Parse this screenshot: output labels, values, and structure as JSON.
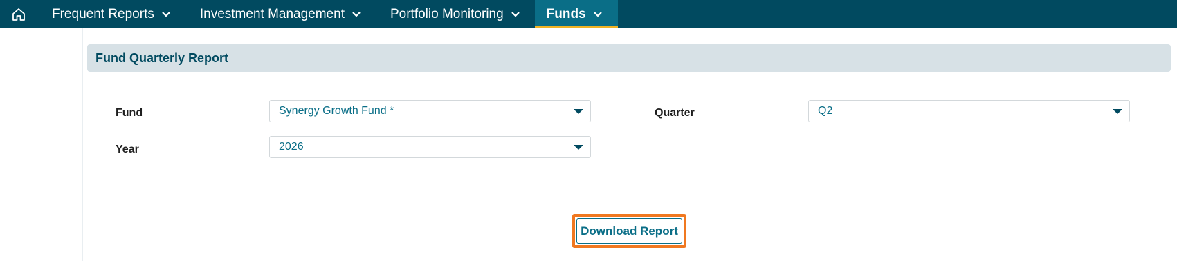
{
  "nav": {
    "home_icon": "home-icon",
    "items": [
      {
        "label": "Frequent Reports"
      },
      {
        "label": "Investment Management"
      },
      {
        "label": "Portfolio Monitoring"
      },
      {
        "label": "Funds",
        "active": true
      }
    ]
  },
  "panel": {
    "title": "Fund Quarterly Report"
  },
  "form": {
    "fund_label": "Fund",
    "fund_value": "Synergy Growth Fund *",
    "quarter_label": "Quarter",
    "quarter_value": "Q2",
    "year_label": "Year",
    "year_value": "2026"
  },
  "actions": {
    "download_label": "Download Report"
  },
  "colors": {
    "nav_bg": "#014a60",
    "nav_active_bg": "#0a6e87",
    "nav_active_underline": "#f0b323",
    "accent_text": "#0a6e87",
    "highlight_outline": "#f07820",
    "panel_header_bg": "#d7e1e6"
  }
}
